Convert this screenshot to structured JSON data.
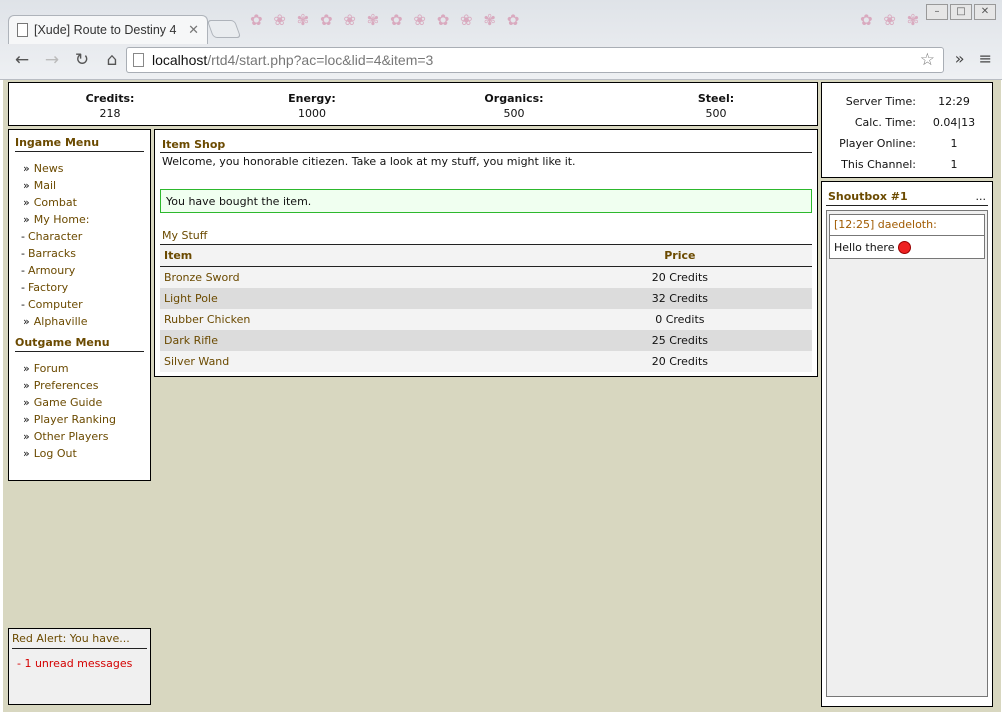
{
  "browser": {
    "tab_title": "[Xude] Route to Destiny 4",
    "url_host": "localhost",
    "url_path": "/rtd4/start.php?ac=loc&lid=4&item=3"
  },
  "resources": [
    {
      "label": "Credits:",
      "value": "218"
    },
    {
      "label": "Energy:",
      "value": "1000"
    },
    {
      "label": "Organics:",
      "value": "500"
    },
    {
      "label": "Steel:",
      "value": "500"
    }
  ],
  "ingame_menu": {
    "title": "Ingame Menu",
    "items": [
      {
        "prefix": "»",
        "label": "News"
      },
      {
        "prefix": "»",
        "label": "Mail"
      },
      {
        "prefix": "»",
        "label": "Combat"
      },
      {
        "prefix": "»",
        "label": "My Home:"
      },
      {
        "prefix": "-",
        "label": "Character"
      },
      {
        "prefix": "-",
        "label": "Barracks"
      },
      {
        "prefix": "-",
        "label": "Armoury"
      },
      {
        "prefix": "-",
        "label": "Factory"
      },
      {
        "prefix": "-",
        "label": "Computer"
      },
      {
        "prefix": "»",
        "label": "Alphaville"
      }
    ]
  },
  "outgame_menu": {
    "title": "Outgame Menu",
    "items": [
      {
        "prefix": "»",
        "label": "Forum"
      },
      {
        "prefix": "»",
        "label": "Preferences"
      },
      {
        "prefix": "»",
        "label": "Game Guide"
      },
      {
        "prefix": "»",
        "label": "Player Ranking"
      },
      {
        "prefix": "»",
        "label": "Other Players"
      },
      {
        "prefix": "»",
        "label": "Log Out"
      }
    ]
  },
  "shop": {
    "title": "Item Shop",
    "welcome": "Welcome, you honorable citiezen. Take a look at my stuff, you might like it.",
    "success": "You have bought the item.",
    "stuff_title": "My Stuff",
    "col_item": "Item",
    "col_price": "Price",
    "rows": [
      {
        "item": "Bronze Sword",
        "price": "20 Credits"
      },
      {
        "item": "Light Pole",
        "price": "32 Credits"
      },
      {
        "item": "Rubber Chicken",
        "price": "0 Credits"
      },
      {
        "item": "Dark Rifle",
        "price": "25 Credits"
      },
      {
        "item": "Silver Wand",
        "price": "20 Credits"
      }
    ]
  },
  "alert": {
    "title": "Red Alert: You have...",
    "message": "- 1 unread messages"
  },
  "server": [
    {
      "label": "Server Time:",
      "value": "12:29"
    },
    {
      "label": "Calc. Time:",
      "value": "0.04|13"
    },
    {
      "label": "Player Online:",
      "value": "1"
    },
    {
      "label": "This Channel:",
      "value": "1"
    }
  ],
  "shoutbox": {
    "title": "Shoutbox #1",
    "more": "...",
    "messages": [
      {
        "meta": "[12:25] daedeloth:",
        "text": "Hello there"
      }
    ]
  }
}
